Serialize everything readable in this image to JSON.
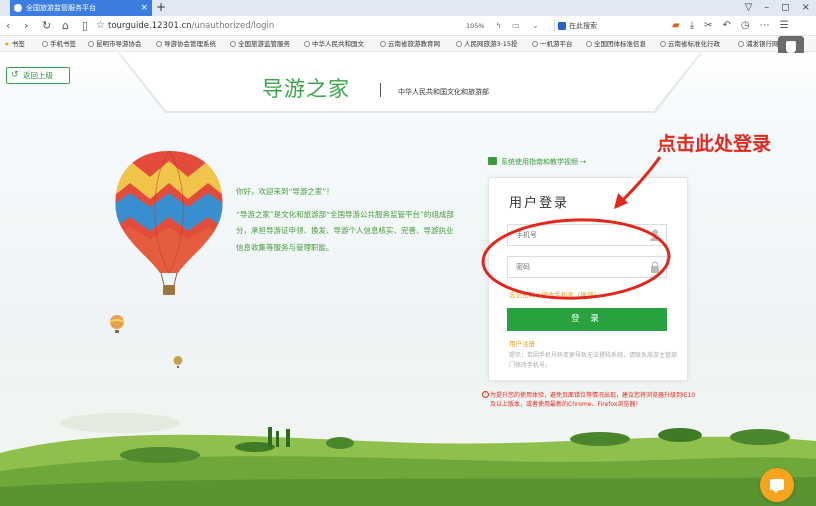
{
  "browser": {
    "tab_title": "全国旅游监管服务平台",
    "tab_close": "×",
    "new_tab": "+",
    "url_host": "tourguide.12301.cn",
    "url_path": "/unauthorized/login",
    "zoom": "105%",
    "search_placeholder": "在此搜索",
    "window_buttons": [
      "▽",
      "–",
      "◻",
      "×"
    ],
    "right_toolbar_icons": [
      "game-icon",
      "download-icon",
      "scissors-icon",
      "undo-icon",
      "history-icon",
      "more-icon",
      "menu-icon"
    ]
  },
  "bookmarks": [
    "书签",
    "手机书签",
    "昆明市导游协会",
    "导游协会管理系统",
    "全国旅游监管服务",
    "中华人民共和国文",
    "云南省旅游教育网",
    "人民网旅游3·15投",
    "一机游平台",
    "全国团体标准信息",
    "云南省标准化行政",
    "浦发银行网"
  ],
  "page": {
    "back_label": "返回上级",
    "site_title": "导游之家",
    "site_subtitle": "中华人民共和国文化和旅游部",
    "guide_link": "系统使用指南和教学视频 →",
    "annotation": "点击此处登录",
    "intro": {
      "greeting": "你好，欢迎来到“导游之家”！",
      "body": "“导游之家”是文化和旅游部“全国导游公共服务监管平台”的组成部分，承担导游证申领、换发、导游个人信息核实、完善、导游执业信息收集等服务与管理职能。"
    }
  },
  "login": {
    "title": "用户登录",
    "phone_placeholder": "手机号",
    "password_placeholder": "密码",
    "forgot": "忘记密码 | 修改手机号（换领）",
    "submit": "登 录",
    "register": "用户注册",
    "tip": "提示：若因手机号码变更导致无法登陆系统，请联系旅游主管部门修改手机号。",
    "browser_warning": "为提升您的使用体验，避免页面错位等情况出现，建议您将浏览器升级到IE10及以上版本，或者使用最新的Chrome、Firefox浏览器！"
  },
  "colors": {
    "brand_green": "#27a23f",
    "annotation_red": "#e3271c",
    "link_orange": "#e0a020",
    "chat_orange": "#f5a51d"
  }
}
